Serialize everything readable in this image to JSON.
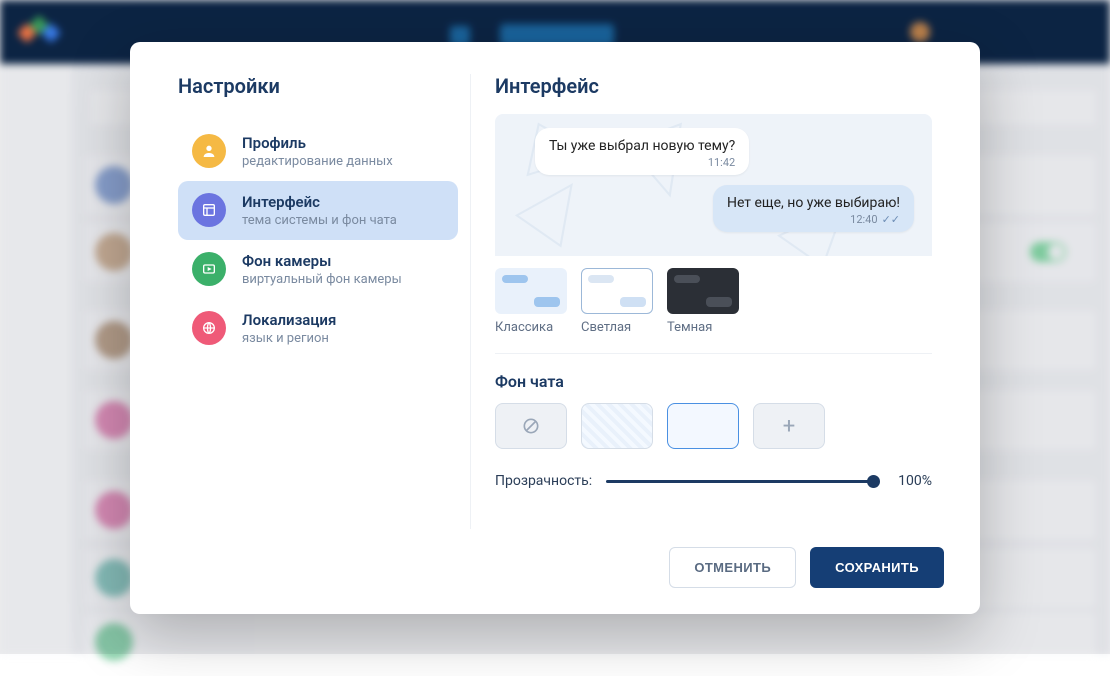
{
  "modal": {
    "title": "Настройки",
    "panel_title": "Интерфейс",
    "nav": [
      {
        "id": "profile",
        "title": "Профиль",
        "sub": "редактирование данных",
        "icon": "user-icon",
        "color": "#f5b944",
        "active": false
      },
      {
        "id": "interface",
        "title": "Интерфейс",
        "sub": "тема системы и фон чата",
        "icon": "layout-icon",
        "color": "#6b74e0",
        "active": true
      },
      {
        "id": "camera",
        "title": "Фон камеры",
        "sub": "виртуальный фон камеры",
        "icon": "play-icon",
        "color": "#3bb06a",
        "active": false
      },
      {
        "id": "locale",
        "title": "Локализация",
        "sub": "язык и регион",
        "icon": "globe-icon",
        "color": "#ef5a78",
        "active": false
      }
    ],
    "preview": {
      "in": {
        "text": "Ты уже выбрал новую тему?",
        "time": "11:42"
      },
      "out": {
        "text": "Нет еще, но уже выбираю!",
        "time": "12:40"
      }
    },
    "themes": {
      "items": [
        {
          "id": "classic",
          "label": "Классика"
        },
        {
          "id": "light",
          "label": "Светлая"
        },
        {
          "id": "dark",
          "label": "Темная"
        }
      ],
      "selected": "light"
    },
    "chat_bg": {
      "heading": "Фон чата",
      "options": [
        "none",
        "pattern",
        "solid",
        "add"
      ],
      "selected": "solid"
    },
    "opacity": {
      "label": "Прозрачность:",
      "value": "100%"
    },
    "buttons": {
      "cancel": "ОТМЕНИТЬ",
      "save": "СОХРАНИТЬ"
    }
  }
}
